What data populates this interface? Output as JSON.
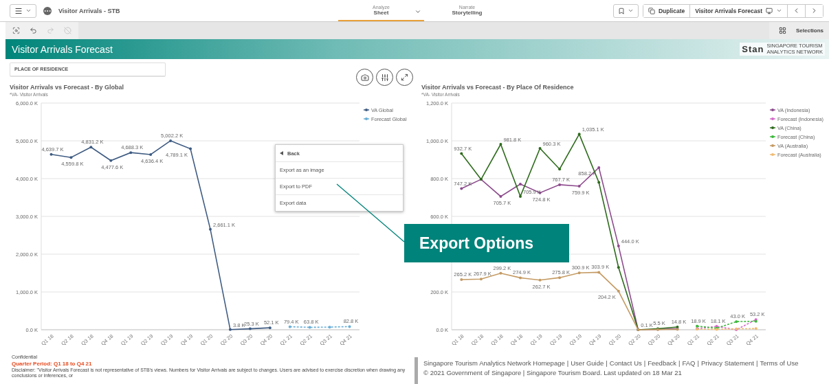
{
  "app": {
    "title": "Visitor Arrivals - STB"
  },
  "tabs": [
    {
      "caption": "Analyze",
      "label": "Sheet",
      "selected": true
    },
    {
      "caption": "Narrate",
      "label": "Storytelling",
      "selected": false
    }
  ],
  "actions": {
    "duplicate": "Duplicate",
    "sheet": "Visitor Arrivals Forecast"
  },
  "toolbar": {
    "tools": [
      {
        "kind": "smart-search",
        "disabled": false
      },
      {
        "kind": "step-back",
        "disabled": false
      },
      {
        "kind": "step-forward",
        "disabled": true
      },
      {
        "kind": "clear",
        "disabled": true
      }
    ],
    "selections": "Selections"
  },
  "banner": {
    "title": "Visitor Arrivals Forecast",
    "logo": {
      "wordmark": "Stan",
      "tagline_1": "SINGAPORE TOURISM",
      "tagline_2": "ANALYTICS NETWORK"
    }
  },
  "filter": {
    "label": "PLACE OF RESIDENCE"
  },
  "charts": [
    {
      "title": "Visitor Arrivals vs Forecast - By Global",
      "subtitle": "*VA- Visitor Arrivals",
      "chart_data": {
        "type": "line",
        "grid": true,
        "legend": true,
        "categories": [
          "Q1 18",
          "Q2 18",
          "Q3 18",
          "Q4 18",
          "Q1 19",
          "Q2 19",
          "Q3 19",
          "Q4 19",
          "Q1 20",
          "Q2 20",
          "Q3 20",
          "Q4 20",
          "Q1 21",
          "Q2 21",
          "Q3 21",
          "Q4 21"
        ],
        "ylim": [
          0,
          6000
        ],
        "yticks": [
          {
            "value": 0,
            "label": "0.0 K"
          },
          {
            "value": 1000,
            "label": "1,000.0 K"
          },
          {
            "value": 2000,
            "label": "2,000.0 K"
          },
          {
            "value": 3000,
            "label": "3,000.0 K"
          },
          {
            "value": 4000,
            "label": "4,000.0 K"
          },
          {
            "value": 5000,
            "label": "5,000.0 K"
          },
          {
            "value": 6000,
            "label": "6,000.0 K"
          }
        ],
        "series": [
          {
            "name": "VA Global",
            "color": "#3e5b82",
            "line_style": "solid",
            "values": [
              4639.7,
              4559.8,
              4831.2,
              4477.6,
              4688.3,
              4636.4,
              5002.2,
              4789.1,
              2661.1,
              3.8,
              25.3,
              52.1,
              null,
              null,
              null,
              null
            ],
            "value_labels": [
              "4,639.7 K",
              "4,559.8 K",
              "4,831.2 K",
              "4,477.6 K",
              "4,688.3 K",
              "4,636.4 K",
              "5,002.2 K",
              "4,789.1 K",
              "2,661.1 K",
              "3.8 K",
              "25.3 K",
              "52.1 K",
              null,
              null,
              null,
              null
            ]
          },
          {
            "name": "Forecast Global",
            "color": "#6aaed6",
            "line_style": "dashed",
            "values": [
              null,
              null,
              null,
              null,
              null,
              null,
              null,
              null,
              null,
              null,
              null,
              null,
              79.4,
              63.8,
              70,
              82.8
            ],
            "value_labels": [
              null,
              null,
              null,
              null,
              null,
              null,
              null,
              null,
              null,
              null,
              null,
              null,
              "79.4 K",
              "63.8 K",
              null,
              "82.8 K"
            ]
          }
        ]
      }
    },
    {
      "title": "Visitor Arrivals vs Forecast - By Place Of Residence",
      "subtitle": "*VA- Visitor Arrivals",
      "chart_data": {
        "type": "line",
        "grid": true,
        "legend": true,
        "categories": [
          "Q1 18",
          "Q2 18",
          "Q3 18",
          "Q4 18",
          "Q1 19",
          "Q2 19",
          "Q3 19",
          "Q4 19",
          "Q1 20",
          "Q2 20",
          "Q3 20",
          "Q4 20",
          "Q1 21",
          "Q2 21",
          "Q3 21",
          "Q4 21"
        ],
        "ylim": [
          0,
          1200
        ],
        "yticks": [
          {
            "value": 0,
            "label": "0.0 K"
          },
          {
            "value": 200,
            "label": "200.0 K"
          },
          {
            "value": 600,
            "label": "600.0 K"
          },
          {
            "value": 800,
            "label": "800.0 K"
          },
          {
            "value": 1000,
            "label": "1,000.0 K"
          },
          {
            "value": 1200,
            "label": "1,200.0 K"
          }
        ],
        "series": [
          {
            "name": "VA (Indonesia)",
            "color": "#8c4a8c",
            "line_style": "solid",
            "values": [
              747.2,
              796,
              705.7,
              771,
              724.8,
              767.7,
              759.9,
              858.2,
              444.0,
              0,
              2,
              5,
              null,
              null,
              null,
              null
            ],
            "value_labels": [
              "747.2 K",
              null,
              "705.7 K",
              null,
              "724.8 K",
              "767.7 K",
              "759.9 K",
              "858.2 K",
              "444.0 K",
              null,
              null,
              null,
              null,
              null,
              null,
              null
            ]
          },
          {
            "name": "Forecast (Indonesia)",
            "color": "#d56bc8",
            "line_style": "dashed",
            "values": [
              null,
              null,
              null,
              null,
              null,
              null,
              null,
              null,
              null,
              null,
              null,
              null,
              6,
              18.1,
              0,
              53.2
            ],
            "value_labels": [
              null,
              null,
              null,
              null,
              null,
              null,
              null,
              null,
              null,
              null,
              null,
              null,
              null,
              "18.1 K",
              null,
              "53.2 K"
            ]
          },
          {
            "name": "VA (China)",
            "color": "#2e6b1c",
            "line_style": "solid",
            "values": [
              932.7,
              796,
              981.8,
              705.9,
              960.3,
              850,
              1035.1,
              780,
              330,
              0.1,
              5.5,
              14.8,
              null,
              null,
              null,
              null
            ],
            "value_labels": [
              "932.7 K",
              null,
              "981.8 K",
              "705.9 K",
              "960.3 K",
              null,
              "1,035.1 K",
              null,
              null,
              "0.1 K",
              "5.5 K",
              "14.8 K",
              null,
              null,
              null,
              null
            ]
          },
          {
            "name": "Forecast (China)",
            "color": "#3cb83c",
            "line_style": "dashed",
            "values": [
              null,
              null,
              null,
              null,
              null,
              null,
              null,
              null,
              null,
              null,
              null,
              null,
              18.9,
              8,
              43.0,
              45
            ],
            "value_labels": [
              null,
              null,
              null,
              null,
              null,
              null,
              null,
              null,
              null,
              null,
              null,
              null,
              "18.9 K",
              null,
              "43.0 K",
              null
            ]
          },
          {
            "name": "VA (Australia)",
            "color": "#c49a62",
            "line_style": "solid",
            "values": [
              265.2,
              267.9,
              299.2,
              274.9,
              262.7,
              275.8,
              300.9,
              303.9,
              204.2,
              0,
              1,
              2,
              null,
              null,
              null,
              null
            ],
            "value_labels": [
              "265.2 K",
              "267.9 K",
              "299.2 K",
              "274.9 K",
              "262.7 K",
              "275.8 K",
              "300.9 K",
              "303.9 K",
              "204.2 K",
              null,
              null,
              null,
              null,
              null,
              null,
              null
            ]
          },
          {
            "name": "Forecast (Australia)",
            "color": "#f0bb72",
            "line_style": "dashed",
            "values": [
              null,
              null,
              null,
              null,
              null,
              null,
              null,
              null,
              null,
              null,
              null,
              null,
              3,
              2,
              5,
              6
            ]
          }
        ]
      }
    }
  ],
  "menu": {
    "back": "Back",
    "items": [
      "Export as an image",
      "Export to PDF",
      "Export data"
    ]
  },
  "callout": {
    "text": "Export Options"
  },
  "footer": {
    "confidential": "Confidential",
    "period": "Quarter Period: Q1 18 to Q4 21",
    "disclaimer": "Disclaimer: \"Visitor Arrivals Forecast is not representative of STB's views. Numbers for Visitor Arrivals are subject to changes. Users are advised to exercise discretion when drawing any conclusions or inferences, or",
    "links": [
      "Singapore Tourism Analytics Network Homepage",
      "User Guide",
      "Contact Us",
      "Feedback",
      "FAQ",
      "Privacy Statement",
      "Terms of Use"
    ],
    "separator": "|",
    "copyright": "© 2021 Government of Singapore | Singapore Tourism Board. Last updated on 18 Mar 21"
  }
}
